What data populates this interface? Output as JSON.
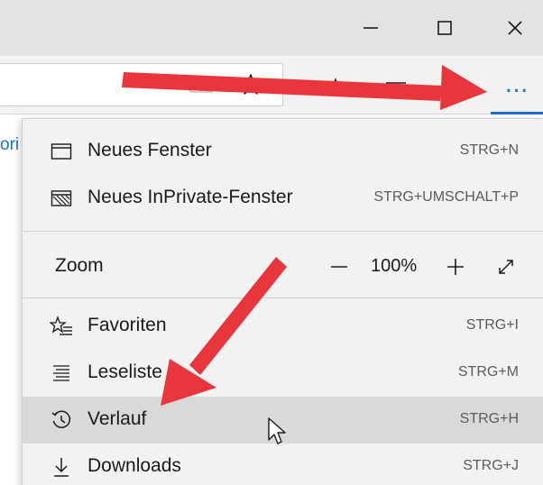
{
  "window": {
    "minimize_icon": "minimize-icon",
    "maximize_icon": "maximize-icon",
    "close_icon": "close-icon"
  },
  "toolbar": {
    "reading_view_icon": "reading-view-icon",
    "favorite_star_icon": "star-icon",
    "favorites_hub_icon": "favorites-bar-icon",
    "hub_icon": "hub-icon",
    "notes_icon": "notes-icon",
    "more_label": "…",
    "more_icon": "more-icon"
  },
  "page": {
    "edge_text": "ori"
  },
  "menu": {
    "items_top": [
      {
        "label": "Neues Fenster",
        "shortcut": "STRG+N",
        "icon": "window-icon"
      },
      {
        "label": "Neues InPrivate-Fenster",
        "shortcut": "STRG+UMSCHALT+P",
        "icon": "inprivate-icon"
      }
    ],
    "zoom": {
      "label": "Zoom",
      "value": "100%",
      "minus_icon": "zoom-out-icon",
      "plus_icon": "zoom-in-icon",
      "fullscreen_icon": "fullscreen-icon"
    },
    "items_bottom": [
      {
        "label": "Favoriten",
        "shortcut": "STRG+I",
        "icon": "favorites-icon"
      },
      {
        "label": "Leseliste",
        "shortcut": "STRG+M",
        "icon": "reading-list-icon"
      },
      {
        "label": "Verlauf",
        "shortcut": "STRG+H",
        "icon": "history-icon",
        "hovered": true
      },
      {
        "label": "Downloads",
        "shortcut": "STRG+J",
        "icon": "download-icon"
      }
    ]
  },
  "annotations": {
    "arrow_color": "#e8363c"
  },
  "colors": {
    "accent": "#1a73c8",
    "menu_bg": "#f2f2f2",
    "hover_bg": "#d9d9d9"
  }
}
